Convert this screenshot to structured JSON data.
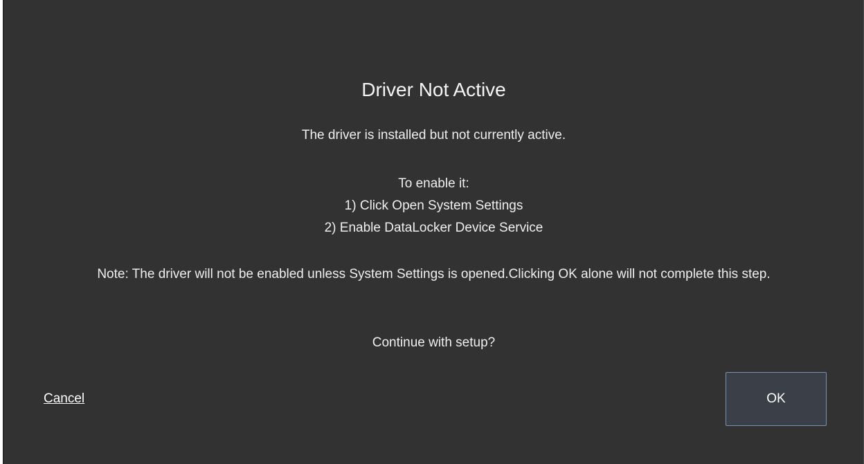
{
  "dialog": {
    "title": "Driver Not Active",
    "message": "The driver is installed but not currently active.",
    "instructions_header": "To enable it:",
    "step_1": "1) Click Open System Settings",
    "step_2": "2) Enable DataLocker Device Service",
    "note": "Note: The driver will not be enabled unless System Settings is opened.Clicking OK alone will not complete this step.",
    "question": "Continue with setup?",
    "cancel_label": "Cancel",
    "ok_label": "OK"
  },
  "colors": {
    "background": "#323232",
    "text": "#f2f2f2",
    "button_border": "#7a90ad",
    "button_fill": "#3b4048"
  }
}
